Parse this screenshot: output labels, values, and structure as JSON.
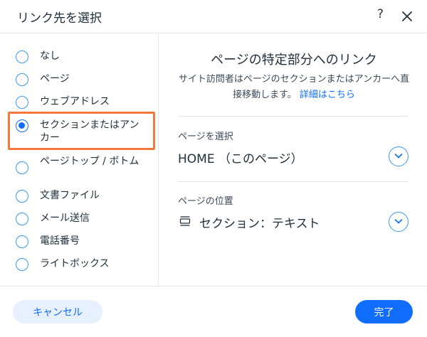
{
  "header": {
    "title": "リンク先を選択",
    "help_label": "?"
  },
  "options": [
    {
      "label": "なし",
      "selected": false
    },
    {
      "label": "ページ",
      "selected": false
    },
    {
      "label": "ウェブアドレス",
      "selected": false
    },
    {
      "label": "セクションまたはアンカー",
      "selected": true
    },
    {
      "label": "ページトップ / ボトム",
      "selected": false
    },
    {
      "label": "文書ファイル",
      "selected": false
    },
    {
      "label": "メール送信",
      "selected": false
    },
    {
      "label": "電話番号",
      "selected": false
    },
    {
      "label": "ライトボックス",
      "selected": false
    }
  ],
  "right": {
    "title": "ページの特定部分へのリンク",
    "description": "サイト訪問者はページのセクションまたはアンカーへ直接移動します。",
    "more_link": "詳細はこちら",
    "page_field": {
      "label": "ページを選択",
      "value": "HOME （このページ）"
    },
    "position_field": {
      "label": "ページの位置",
      "value": "セクション：テキスト"
    }
  },
  "footer": {
    "cancel_label": "キャンセル",
    "done_label": "完了"
  },
  "colors": {
    "accent": "#116dff",
    "highlight": "#f5773e"
  }
}
